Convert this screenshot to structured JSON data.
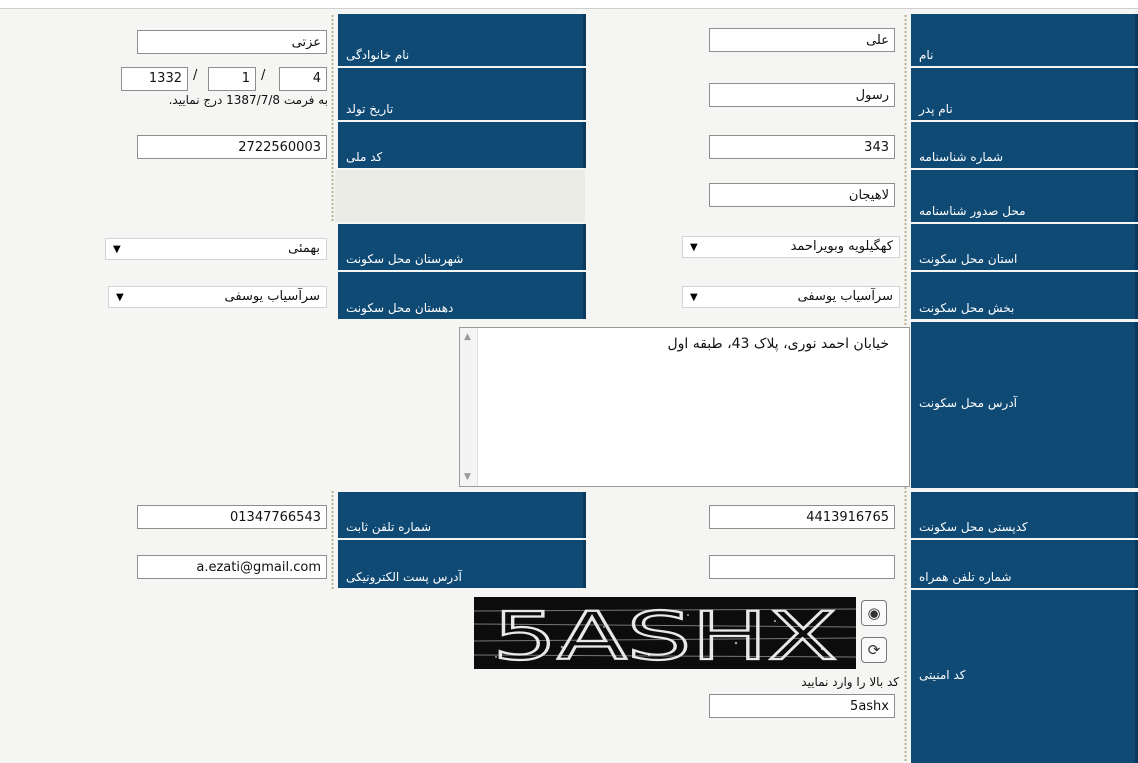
{
  "form": {
    "first_name": {
      "label": "نام",
      "value": "علی"
    },
    "last_name": {
      "label": "نام خانوادگی",
      "value": "عزتی"
    },
    "father_name": {
      "label": "نام پدر",
      "value": "رسول"
    },
    "birth_date": {
      "label": "تاریخ تولد",
      "year": "1332",
      "month": "1",
      "day": "4",
      "slash": "/",
      "hint": "به فرمت 1387/7/8 درج نمایید."
    },
    "id_number": {
      "label": "شماره شناسنامه",
      "value": "343"
    },
    "national_code": {
      "label": "کد ملی",
      "value": "2722560003"
    },
    "id_issue_place": {
      "label": "محل صدور شناسنامه",
      "value": "لاهیجان"
    },
    "province": {
      "label": "استان محل سکونت",
      "selected": "کهگیلویه وبویراحمد"
    },
    "county": {
      "label": "شهرستان محل سکونت",
      "selected": "بهمئی"
    },
    "district": {
      "label": "بخش محل سکونت",
      "selected": "سرآسیاب یوسفی"
    },
    "rural_district": {
      "label": "دهستان محل سکونت",
      "selected": "سرآسیاب یوسفی"
    },
    "address": {
      "label": "آدرس محل سکونت",
      "value": "خیابان احمد نوری، پلاک 43، طبقه اول"
    },
    "postal_code": {
      "label": "کدپستی محل سکونت",
      "value": "4413916765"
    },
    "phone": {
      "label": "شماره تلفن ثابت",
      "value": "01347766543"
    },
    "mobile": {
      "label": "شماره تلفن همراه",
      "value": ""
    },
    "email": {
      "label": "آدرس پست الکترونیکی",
      "value": "a.ezati@gmail.com"
    },
    "security": {
      "label": "کد امنیتی",
      "captcha_text": "5ASHX",
      "hint": "کد بالا را وارد نمایید",
      "value": "5ashx"
    }
  },
  "icons": {
    "dropdown": "dropdown-arrow-icon",
    "audio": "audio-icon",
    "refresh": "refresh-icon",
    "scroll_up": "scroll-up-icon",
    "scroll_down": "scroll-down-icon"
  },
  "colors": {
    "label_bg": "#0f4a75",
    "page_bg": "#f5f5f3",
    "captcha_bg": "#0c0c0c"
  }
}
